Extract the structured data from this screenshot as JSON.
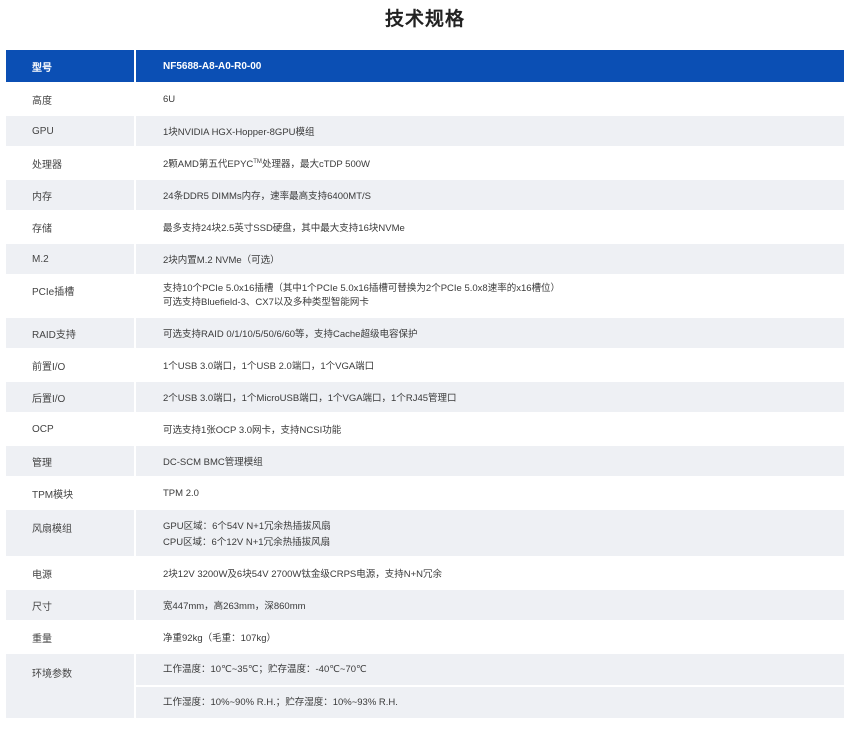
{
  "title": "技术规格",
  "header": {
    "key": "型号",
    "value": "NF5688-A8-A0-R0-00"
  },
  "rows": [
    {
      "key": "高度",
      "lines": [
        "6U"
      ]
    },
    {
      "key": "GPU",
      "lines": [
        "1块NVIDIA HGX-Hopper-8GPU模组"
      ]
    },
    {
      "key": "处理器",
      "lines": [
        "2颗AMD第五代EPYC",
        "TM",
        "处理器，最大cTDP 500W"
      ]
    },
    {
      "key": "内存",
      "lines": [
        "24条DDR5 DIMMs内存，速率最高支持6400MT/S"
      ]
    },
    {
      "key": "存储",
      "lines": [
        "最多支持24块2.5英寸SSD硬盘，其中最大支持16块NVMe"
      ]
    },
    {
      "key": "M.2",
      "lines": [
        "2块内置M.2 NVMe（可选）"
      ]
    },
    {
      "key": "PCIe插槽",
      "lines": [
        "支持10个PCIe 5.0x16插槽（其中1个PCIe 5.0x16插槽可替换为2个PCIe 5.0x8速率的x16槽位）",
        "可选支持Bluefield-3、CX7以及多种类型智能网卡"
      ]
    },
    {
      "key": "RAID支持",
      "lines": [
        "可选支持RAID 0/1/10/5/50/6/60等，支持Cache超级电容保护"
      ]
    },
    {
      "key": "前置I/O",
      "lines": [
        "1个USB 3.0端口，1个USB 2.0端口，1个VGA端口"
      ]
    },
    {
      "key": "后置I/O",
      "lines": [
        "2个USB 3.0端口，1个MicroUSB端口，1个VGA端口，1个RJ45管理口"
      ]
    },
    {
      "key": "OCP",
      "lines": [
        "可选支持1张OCP 3.0网卡，支持NCSI功能"
      ]
    },
    {
      "key": "管理",
      "lines": [
        "DC-SCM BMC管理模组"
      ]
    },
    {
      "key": "TPM模块",
      "lines": [
        "TPM 2.0"
      ]
    },
    {
      "key": "风扇模组",
      "lines": [
        "GPU区域：6个54V N+1冗余热插拔风扇",
        "CPU区域：6个12V N+1冗余热插拔风扇"
      ]
    },
    {
      "key": "电源",
      "lines": [
        "2块12V 3200W及6块54V 2700W钛金级CRPS电源，支持N+N冗余"
      ]
    },
    {
      "key": "尺寸",
      "lines": [
        "宽447mm，高263mm，深860mm"
      ]
    },
    {
      "key": "重量",
      "lines": [
        "净重92kg（毛重：107kg）"
      ]
    },
    {
      "key": "环境参数",
      "lines": [
        "工作温度：10℃~35℃；贮存温度：-40℃~70℃",
        "工作湿度：10%~90% R.H.；贮存湿度：10%~93% R.H."
      ]
    }
  ],
  "colors": {
    "header_bg": "#0b4fb4",
    "stripe_bg": "#eef0f4"
  }
}
